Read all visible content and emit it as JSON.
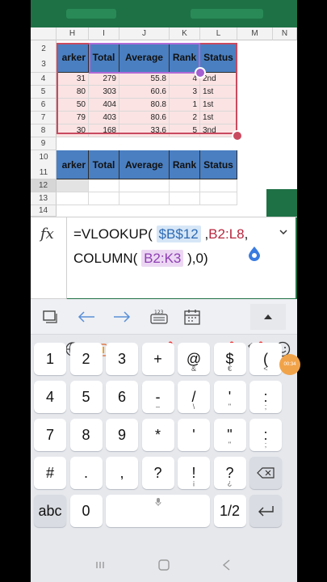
{
  "spreadsheet": {
    "columns": [
      "H",
      "I",
      "J",
      "K",
      "L",
      "M",
      "N"
    ],
    "rows": [
      "2",
      "3",
      "4",
      "5",
      "6",
      "7",
      "8",
      "9",
      "10",
      "11",
      "12",
      "13",
      "14"
    ],
    "header1": [
      "arker",
      "Total",
      "Average",
      "Rank",
      "Status"
    ],
    "data": [
      [
        "31",
        "279",
        "55.8",
        "4",
        "2nd"
      ],
      [
        "80",
        "303",
        "60.6",
        "3",
        "1st"
      ],
      [
        "50",
        "404",
        "80.8",
        "1",
        "1st"
      ],
      [
        "79",
        "403",
        "80.6",
        "2",
        "1st"
      ],
      [
        "30",
        "168",
        "33.6",
        "5",
        "3nd"
      ]
    ],
    "header2": [
      "arker",
      "Total",
      "Average",
      "Rank",
      "Status"
    ]
  },
  "formula_bar": {
    "fx_label": "fx",
    "part1": "=VLOOKUP(",
    "ref1": "$B$12",
    "part2": ",",
    "ref2": "B2:L8",
    "part3": ",",
    "part4": "COLUMN(",
    "ref3": "B2:K3",
    "part5": "),0)"
  },
  "keyboard": {
    "rows": [
      [
        {
          "k": "1"
        },
        {
          "k": "2"
        },
        {
          "k": "3"
        },
        {
          "k": "+"
        },
        {
          "k": "@",
          "s": "&"
        },
        {
          "k": "$",
          "s": "€"
        },
        {
          "k": "(",
          "s": "<"
        }
      ],
      [
        {
          "k": "4"
        },
        {
          "k": "5"
        },
        {
          "k": "6"
        },
        {
          "k": "-",
          "s": "–"
        },
        {
          "k": "/",
          "s": "\\"
        },
        {
          "k": "'",
          "s": "\""
        },
        {
          "k": ":",
          "s": ";"
        }
      ],
      [
        {
          "k": "7"
        },
        {
          "k": "8"
        },
        {
          "k": "9"
        },
        {
          "k": "*"
        },
        {
          "k": "'"
        },
        {
          "k": "\"",
          "s": "\""
        },
        {
          "k": ":",
          "s": ";"
        }
      ],
      [
        {
          "k": "#"
        },
        {
          "k": "."
        },
        {
          "k": ","
        },
        {
          "k": "?"
        },
        {
          "k": "!",
          "s": "¡"
        },
        {
          "k": "?",
          "s": "¿"
        }
      ],
      [
        {
          "k": "abc"
        },
        {
          "k": "0"
        },
        {
          "k": ""
        },
        {
          "k": "1/2"
        }
      ]
    ]
  },
  "badge": "00:34"
}
